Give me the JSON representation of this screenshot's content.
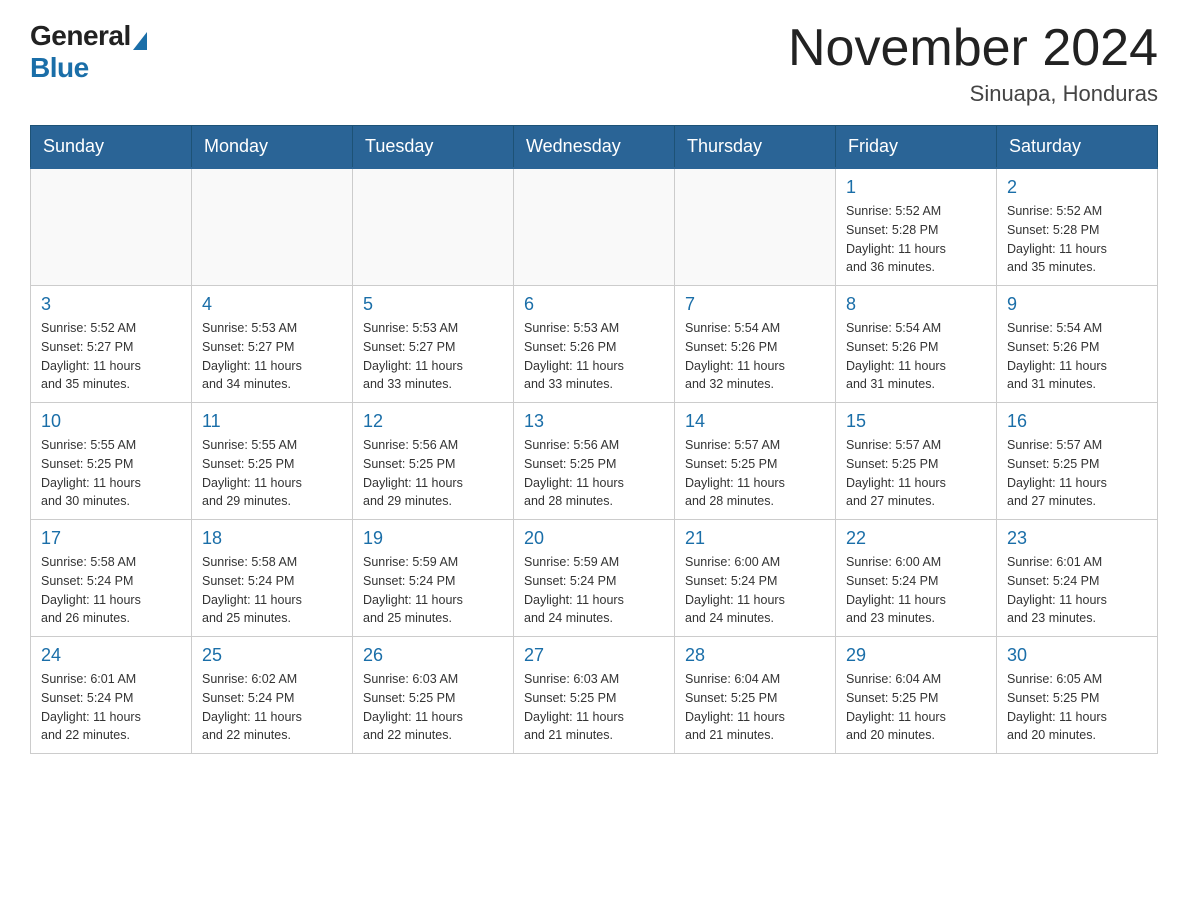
{
  "logo": {
    "general": "General",
    "blue": "Blue"
  },
  "title": "November 2024",
  "subtitle": "Sinuapa, Honduras",
  "weekdays": [
    "Sunday",
    "Monday",
    "Tuesday",
    "Wednesday",
    "Thursday",
    "Friday",
    "Saturday"
  ],
  "weeks": [
    [
      {
        "day": "",
        "info": ""
      },
      {
        "day": "",
        "info": ""
      },
      {
        "day": "",
        "info": ""
      },
      {
        "day": "",
        "info": ""
      },
      {
        "day": "",
        "info": ""
      },
      {
        "day": "1",
        "info": "Sunrise: 5:52 AM\nSunset: 5:28 PM\nDaylight: 11 hours\nand 36 minutes."
      },
      {
        "day": "2",
        "info": "Sunrise: 5:52 AM\nSunset: 5:28 PM\nDaylight: 11 hours\nand 35 minutes."
      }
    ],
    [
      {
        "day": "3",
        "info": "Sunrise: 5:52 AM\nSunset: 5:27 PM\nDaylight: 11 hours\nand 35 minutes."
      },
      {
        "day": "4",
        "info": "Sunrise: 5:53 AM\nSunset: 5:27 PM\nDaylight: 11 hours\nand 34 minutes."
      },
      {
        "day": "5",
        "info": "Sunrise: 5:53 AM\nSunset: 5:27 PM\nDaylight: 11 hours\nand 33 minutes."
      },
      {
        "day": "6",
        "info": "Sunrise: 5:53 AM\nSunset: 5:26 PM\nDaylight: 11 hours\nand 33 minutes."
      },
      {
        "day": "7",
        "info": "Sunrise: 5:54 AM\nSunset: 5:26 PM\nDaylight: 11 hours\nand 32 minutes."
      },
      {
        "day": "8",
        "info": "Sunrise: 5:54 AM\nSunset: 5:26 PM\nDaylight: 11 hours\nand 31 minutes."
      },
      {
        "day": "9",
        "info": "Sunrise: 5:54 AM\nSunset: 5:26 PM\nDaylight: 11 hours\nand 31 minutes."
      }
    ],
    [
      {
        "day": "10",
        "info": "Sunrise: 5:55 AM\nSunset: 5:25 PM\nDaylight: 11 hours\nand 30 minutes."
      },
      {
        "day": "11",
        "info": "Sunrise: 5:55 AM\nSunset: 5:25 PM\nDaylight: 11 hours\nand 29 minutes."
      },
      {
        "day": "12",
        "info": "Sunrise: 5:56 AM\nSunset: 5:25 PM\nDaylight: 11 hours\nand 29 minutes."
      },
      {
        "day": "13",
        "info": "Sunrise: 5:56 AM\nSunset: 5:25 PM\nDaylight: 11 hours\nand 28 minutes."
      },
      {
        "day": "14",
        "info": "Sunrise: 5:57 AM\nSunset: 5:25 PM\nDaylight: 11 hours\nand 28 minutes."
      },
      {
        "day": "15",
        "info": "Sunrise: 5:57 AM\nSunset: 5:25 PM\nDaylight: 11 hours\nand 27 minutes."
      },
      {
        "day": "16",
        "info": "Sunrise: 5:57 AM\nSunset: 5:25 PM\nDaylight: 11 hours\nand 27 minutes."
      }
    ],
    [
      {
        "day": "17",
        "info": "Sunrise: 5:58 AM\nSunset: 5:24 PM\nDaylight: 11 hours\nand 26 minutes."
      },
      {
        "day": "18",
        "info": "Sunrise: 5:58 AM\nSunset: 5:24 PM\nDaylight: 11 hours\nand 25 minutes."
      },
      {
        "day": "19",
        "info": "Sunrise: 5:59 AM\nSunset: 5:24 PM\nDaylight: 11 hours\nand 25 minutes."
      },
      {
        "day": "20",
        "info": "Sunrise: 5:59 AM\nSunset: 5:24 PM\nDaylight: 11 hours\nand 24 minutes."
      },
      {
        "day": "21",
        "info": "Sunrise: 6:00 AM\nSunset: 5:24 PM\nDaylight: 11 hours\nand 24 minutes."
      },
      {
        "day": "22",
        "info": "Sunrise: 6:00 AM\nSunset: 5:24 PM\nDaylight: 11 hours\nand 23 minutes."
      },
      {
        "day": "23",
        "info": "Sunrise: 6:01 AM\nSunset: 5:24 PM\nDaylight: 11 hours\nand 23 minutes."
      }
    ],
    [
      {
        "day": "24",
        "info": "Sunrise: 6:01 AM\nSunset: 5:24 PM\nDaylight: 11 hours\nand 22 minutes."
      },
      {
        "day": "25",
        "info": "Sunrise: 6:02 AM\nSunset: 5:24 PM\nDaylight: 11 hours\nand 22 minutes."
      },
      {
        "day": "26",
        "info": "Sunrise: 6:03 AM\nSunset: 5:25 PM\nDaylight: 11 hours\nand 22 minutes."
      },
      {
        "day": "27",
        "info": "Sunrise: 6:03 AM\nSunset: 5:25 PM\nDaylight: 11 hours\nand 21 minutes."
      },
      {
        "day": "28",
        "info": "Sunrise: 6:04 AM\nSunset: 5:25 PM\nDaylight: 11 hours\nand 21 minutes."
      },
      {
        "day": "29",
        "info": "Sunrise: 6:04 AM\nSunset: 5:25 PM\nDaylight: 11 hours\nand 20 minutes."
      },
      {
        "day": "30",
        "info": "Sunrise: 6:05 AM\nSunset: 5:25 PM\nDaylight: 11 hours\nand 20 minutes."
      }
    ]
  ]
}
